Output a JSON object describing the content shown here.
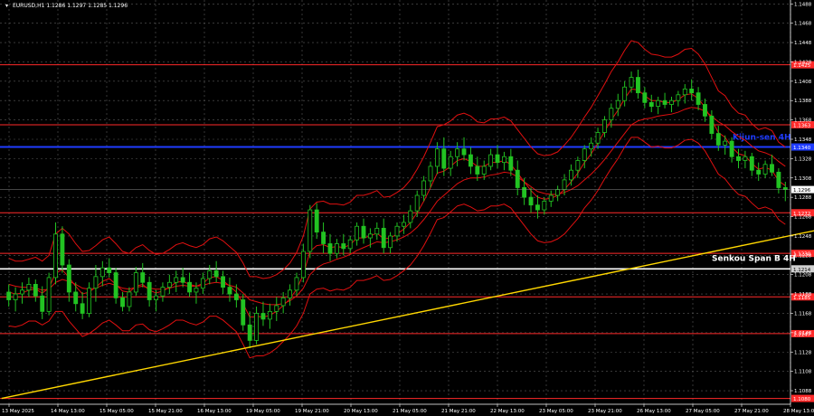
{
  "chart_data": {
    "type": "candlestick",
    "header": "EURUSD,H1  1.1286 1.1297 1.1285 1.1296",
    "ylim": [
      1.1074,
      1.1492
    ],
    "y_ticks": [
      "1.1488",
      "1.1468",
      "1.1448",
      "1.1428",
      "1.1408",
      "1.1388",
      "1.1368",
      "1.1348",
      "1.1328",
      "1.1308",
      "1.1288",
      "1.1268",
      "1.1248",
      "1.1228",
      "1.1208",
      "1.1188",
      "1.1168",
      "1.1148",
      "1.1128",
      "1.1108",
      "1.1088"
    ],
    "x_ticks": [
      "13 May 2025",
      "14 May 13:00",
      "15 May 05:00",
      "15 May 21:00",
      "16 May 13:00",
      "19 May 05:00",
      "19 May 21:00",
      "20 May 13:00",
      "21 May 05:00",
      "21 May 21:00",
      "22 May 13:00",
      "23 May 05:00",
      "23 May 21:00",
      "26 May 13:00",
      "27 May 05:00",
      "27 May 21:00",
      "28 May 13:00"
    ],
    "current_price": "1.1296",
    "levels": [
      {
        "price": 1.1425,
        "label": "1.1425",
        "color": "#ff2a2a"
      },
      {
        "price": 1.1363,
        "label": "1.1363",
        "color": "#ff2a2a"
      },
      {
        "price": 1.1272,
        "label": "1.1272",
        "color": "#ff2a2a"
      },
      {
        "price": 1.123,
        "label": "1.1230",
        "color": "#ff2a2a"
      },
      {
        "price": 1.1185,
        "label": "1.1185",
        "color": "#ff2a2a"
      },
      {
        "price": 1.1147,
        "label": "1.1147",
        "color": "#ff2a2a"
      },
      {
        "price": 1.108,
        "label": "1.1080",
        "color": "#ff2a2a"
      }
    ],
    "kijun": {
      "price": 1.134,
      "label": "Kijun-sen 4H",
      "tag": "1.1340",
      "color": "#1f3cff"
    },
    "senkou": {
      "price": 1.1214,
      "label": "Senkou Span B 4H",
      "tag": "1.1214",
      "color": "#ffffff"
    },
    "trendline": {
      "from": {
        "x": 0,
        "price": 1.108
      },
      "to": {
        "x": 155,
        "price": 1.1303
      },
      "color": "#ffd700"
    },
    "ohlc": [
      [
        1.119,
        1.1198,
        1.1175,
        1.1182
      ],
      [
        1.1182,
        1.1195,
        1.117,
        1.1188
      ],
      [
        1.1188,
        1.12,
        1.1178,
        1.1192
      ],
      [
        1.1192,
        1.1205,
        1.1185,
        1.1198
      ],
      [
        1.1198,
        1.1203,
        1.118,
        1.1186
      ],
      [
        1.1186,
        1.1196,
        1.1162,
        1.117
      ],
      [
        1.117,
        1.121,
        1.1166,
        1.1205
      ],
      [
        1.1205,
        1.1262,
        1.1198,
        1.125
      ],
      [
        1.125,
        1.1258,
        1.121,
        1.1218
      ],
      [
        1.1218,
        1.1224,
        1.118,
        1.119
      ],
      [
        1.119,
        1.12,
        1.117,
        1.1178
      ],
      [
        1.1178,
        1.119,
        1.1162,
        1.1168
      ],
      [
        1.1168,
        1.12,
        1.1164,
        1.1194
      ],
      [
        1.1194,
        1.1218,
        1.118,
        1.1206
      ],
      [
        1.1206,
        1.1222,
        1.1196,
        1.1215
      ],
      [
        1.1215,
        1.1225,
        1.1205,
        1.121
      ],
      [
        1.121,
        1.1215,
        1.1178,
        1.1184
      ],
      [
        1.1184,
        1.119,
        1.117,
        1.1175
      ],
      [
        1.1175,
        1.1195,
        1.117,
        1.119
      ],
      [
        1.119,
        1.1216,
        1.1186,
        1.121
      ],
      [
        1.121,
        1.122,
        1.1195,
        1.12
      ],
      [
        1.12,
        1.1206,
        1.1175,
        1.1182
      ],
      [
        1.1182,
        1.1192,
        1.117,
        1.1186
      ],
      [
        1.1186,
        1.12,
        1.118,
        1.1195
      ],
      [
        1.1195,
        1.1208,
        1.1188,
        1.12
      ],
      [
        1.12,
        1.1212,
        1.119,
        1.1205
      ],
      [
        1.1205,
        1.1215,
        1.1195,
        1.12
      ],
      [
        1.12,
        1.121,
        1.1185,
        1.119
      ],
      [
        1.119,
        1.12,
        1.1178,
        1.1194
      ],
      [
        1.1194,
        1.121,
        1.1188,
        1.1204
      ],
      [
        1.1204,
        1.1218,
        1.1198,
        1.1212
      ],
      [
        1.1212,
        1.1222,
        1.12,
        1.1206
      ],
      [
        1.1206,
        1.1212,
        1.1188,
        1.1195
      ],
      [
        1.1195,
        1.1205,
        1.118,
        1.1188
      ],
      [
        1.1188,
        1.1198,
        1.1174,
        1.1182
      ],
      [
        1.1182,
        1.1188,
        1.115,
        1.1156
      ],
      [
        1.1156,
        1.117,
        1.1132,
        1.114
      ],
      [
        1.114,
        1.1175,
        1.1136,
        1.1168
      ],
      [
        1.1168,
        1.118,
        1.1155,
        1.1162
      ],
      [
        1.1162,
        1.1178,
        1.1152,
        1.117
      ],
      [
        1.117,
        1.1185,
        1.116,
        1.1176
      ],
      [
        1.1176,
        1.119,
        1.1168,
        1.1184
      ],
      [
        1.1184,
        1.1198,
        1.1176,
        1.1192
      ],
      [
        1.1192,
        1.121,
        1.1186,
        1.1205
      ],
      [
        1.1205,
        1.124,
        1.12,
        1.1232
      ],
      [
        1.1232,
        1.128,
        1.1225,
        1.1275
      ],
      [
        1.1275,
        1.1282,
        1.1245,
        1.1252
      ],
      [
        1.1252,
        1.1262,
        1.123,
        1.124
      ],
      [
        1.124,
        1.125,
        1.1222,
        1.123
      ],
      [
        1.123,
        1.1245,
        1.1225,
        1.124
      ],
      [
        1.124,
        1.125,
        1.1228,
        1.1235
      ],
      [
        1.1235,
        1.1248,
        1.123,
        1.1244
      ],
      [
        1.1244,
        1.1262,
        1.1238,
        1.1258
      ],
      [
        1.1258,
        1.1266,
        1.124,
        1.1246
      ],
      [
        1.1246,
        1.1256,
        1.1236,
        1.125
      ],
      [
        1.125,
        1.1262,
        1.1244,
        1.1256
      ],
      [
        1.1256,
        1.1266,
        1.123,
        1.1236
      ],
      [
        1.1236,
        1.1252,
        1.123,
        1.1248
      ],
      [
        1.1248,
        1.1262,
        1.1242,
        1.1258
      ],
      [
        1.1258,
        1.127,
        1.125,
        1.1262
      ],
      [
        1.1262,
        1.128,
        1.1256,
        1.1274
      ],
      [
        1.1274,
        1.1295,
        1.1268,
        1.129
      ],
      [
        1.129,
        1.131,
        1.1284,
        1.1305
      ],
      [
        1.1305,
        1.1325,
        1.1298,
        1.132
      ],
      [
        1.132,
        1.1345,
        1.1312,
        1.1338
      ],
      [
        1.1338,
        1.135,
        1.131,
        1.1318
      ],
      [
        1.1318,
        1.1336,
        1.131,
        1.133
      ],
      [
        1.133,
        1.1345,
        1.132,
        1.1338
      ],
      [
        1.1338,
        1.135,
        1.1326,
        1.1332
      ],
      [
        1.1332,
        1.134,
        1.1312,
        1.132
      ],
      [
        1.132,
        1.133,
        1.1305,
        1.1312
      ],
      [
        1.1312,
        1.1326,
        1.1306,
        1.132
      ],
      [
        1.132,
        1.1338,
        1.1316,
        1.1332
      ],
      [
        1.1332,
        1.1342,
        1.1318,
        1.1324
      ],
      [
        1.1324,
        1.1335,
        1.1316,
        1.133
      ],
      [
        1.133,
        1.1338,
        1.131,
        1.1316
      ],
      [
        1.1316,
        1.1326,
        1.129,
        1.1298
      ],
      [
        1.1298,
        1.1308,
        1.128,
        1.1288
      ],
      [
        1.1288,
        1.1298,
        1.1272,
        1.128
      ],
      [
        1.128,
        1.129,
        1.1266,
        1.1275
      ],
      [
        1.1275,
        1.1288,
        1.127,
        1.1284
      ],
      [
        1.1284,
        1.1295,
        1.1278,
        1.129
      ],
      [
        1.129,
        1.13,
        1.1284,
        1.1296
      ],
      [
        1.1296,
        1.1312,
        1.129,
        1.1306
      ],
      [
        1.1306,
        1.1322,
        1.13,
        1.1316
      ],
      [
        1.1316,
        1.133,
        1.1308,
        1.1326
      ],
      [
        1.1326,
        1.1342,
        1.1318,
        1.1338
      ],
      [
        1.1338,
        1.135,
        1.133,
        1.1344
      ],
      [
        1.1344,
        1.136,
        1.1338,
        1.1355
      ],
      [
        1.1355,
        1.1372,
        1.135,
        1.1368
      ],
      [
        1.1368,
        1.1385,
        1.136,
        1.138
      ],
      [
        1.138,
        1.1395,
        1.1372,
        1.1388
      ],
      [
        1.1388,
        1.1408,
        1.1382,
        1.1402
      ],
      [
        1.1402,
        1.1418,
        1.1396,
        1.1412
      ],
      [
        1.1412,
        1.142,
        1.139,
        1.1396
      ],
      [
        1.1396,
        1.1402,
        1.138,
        1.1386
      ],
      [
        1.1386,
        1.1394,
        1.1376,
        1.1382
      ],
      [
        1.1382,
        1.1392,
        1.1374,
        1.1388
      ],
      [
        1.1388,
        1.1396,
        1.138,
        1.1384
      ],
      [
        1.1384,
        1.1392,
        1.1376,
        1.1388
      ],
      [
        1.1388,
        1.1398,
        1.1382,
        1.1394
      ],
      [
        1.1394,
        1.1405,
        1.1385,
        1.14
      ],
      [
        1.14,
        1.141,
        1.1388,
        1.1396
      ],
      [
        1.1396,
        1.1402,
        1.1378,
        1.1384
      ],
      [
        1.1384,
        1.139,
        1.1366,
        1.1372
      ],
      [
        1.1372,
        1.1378,
        1.1348,
        1.1354
      ],
      [
        1.1354,
        1.1362,
        1.1336,
        1.1342
      ],
      [
        1.1342,
        1.1352,
        1.1332,
        1.1346
      ],
      [
        1.1346,
        1.135,
        1.1324,
        1.133
      ],
      [
        1.133,
        1.1338,
        1.1318,
        1.1326
      ],
      [
        1.1326,
        1.1336,
        1.1318,
        1.133
      ],
      [
        1.133,
        1.1334,
        1.131,
        1.1316
      ],
      [
        1.1316,
        1.1324,
        1.1305,
        1.1312
      ],
      [
        1.1312,
        1.1326,
        1.1308,
        1.1322
      ],
      [
        1.1322,
        1.1332,
        1.131,
        1.1314
      ],
      [
        1.1314,
        1.1318,
        1.1292,
        1.1298
      ],
      [
        1.1298,
        1.1304,
        1.1284,
        1.1296
      ]
    ],
    "ma_fast": [
      1.119,
      1.1188,
      1.1189,
      1.1192,
      1.1193,
      1.1189,
      1.1194,
      1.121,
      1.1213,
      1.1205,
      1.1196,
      1.1188,
      1.119,
      1.1195,
      1.1201,
      1.1204,
      1.1198,
      1.1191,
      1.119,
      1.1196,
      1.1198,
      1.1192,
      1.1189,
      1.1191,
      1.1195,
      1.12,
      1.1201,
      1.1198,
      1.1196,
      1.1199,
      1.1205,
      1.1206,
      1.1202,
      1.1196,
      1.119,
      1.1178,
      1.1164,
      1.1165,
      1.1164,
      1.1166,
      1.117,
      1.1176,
      1.1183,
      1.1193,
      1.1208,
      1.1232,
      1.1238,
      1.1239,
      1.1236,
      1.1237,
      1.1236,
      1.1239,
      1.1246,
      1.1246,
      1.1248,
      1.1251,
      1.1245,
      1.1246,
      1.125,
      1.1255,
      1.1262,
      1.1272,
      1.1284,
      1.1298,
      1.1313,
      1.1315,
      1.132,
      1.1326,
      1.1328,
      1.1325,
      1.132,
      1.132,
      1.1324,
      1.1324,
      1.1326,
      1.1322,
      1.1313,
      1.1304,
      1.1295,
      1.1288,
      1.1286,
      1.1287,
      1.129,
      1.1296,
      1.1304,
      1.1313,
      1.1324,
      1.1333,
      1.1344,
      1.1356,
      1.1368,
      1.1378,
      1.139,
      1.14,
      1.1399,
      1.1393,
      1.1388,
      1.1388,
      1.1386,
      1.1386,
      1.1389,
      1.1394,
      1.1395,
      1.139,
      1.1381,
      1.1368,
      1.1355,
      1.135,
      1.134,
      1.1333,
      1.1331,
      1.1323,
      1.1317,
      1.1319,
      1.1316,
      1.1305,
      1.13
    ],
    "ma_slow": [
      1.1198,
      1.1196,
      1.1195,
      1.1195,
      1.1194,
      1.1192,
      1.1193,
      1.12,
      1.1203,
      1.1201,
      1.1198,
      1.1194,
      1.1193,
      1.1194,
      1.1197,
      1.1199,
      1.1197,
      1.1194,
      1.1193,
      1.1195,
      1.1196,
      1.1194,
      1.1193,
      1.1193,
      1.1194,
      1.1196,
      1.1197,
      1.1196,
      1.1196,
      1.1197,
      1.1199,
      1.12,
      1.1199,
      1.1197,
      1.1195,
      1.1189,
      1.1182,
      1.118,
      1.1178,
      1.1177,
      1.1177,
      1.1178,
      1.1181,
      1.1186,
      1.1194,
      1.1208,
      1.1215,
      1.1219,
      1.1221,
      1.1224,
      1.1226,
      1.1229,
      1.1233,
      1.1236,
      1.1239,
      1.1242,
      1.1241,
      1.1242,
      1.1244,
      1.1247,
      1.1251,
      1.1257,
      1.1265,
      1.1274,
      1.1284,
      1.129,
      1.1296,
      1.1302,
      1.1306,
      1.1308,
      1.1308,
      1.1309,
      1.1311,
      1.1312,
      1.1314,
      1.1313,
      1.1309,
      1.1304,
      1.1299,
      1.1294,
      1.1292,
      1.1291,
      1.1291,
      1.1293,
      1.1296,
      1.13,
      1.1306,
      1.1312,
      1.1319,
      1.1327,
      1.1336,
      1.1345,
      1.1354,
      1.1363,
      1.1367,
      1.1369,
      1.137,
      1.1372,
      1.1373,
      1.1374,
      1.1376,
      1.1379,
      1.1381,
      1.138,
      1.1377,
      1.1372,
      1.1366,
      1.1362,
      1.1356,
      1.1351,
      1.1347,
      1.1341,
      1.1336,
      1.1334,
      1.1331,
      1.1325,
      1.132
    ],
    "band_upper": [
      1.1225,
      1.1222,
      1.1222,
      1.1224,
      1.1226,
      1.1222,
      1.1228,
      1.125,
      1.1256,
      1.125,
      1.124,
      1.1232,
      1.1233,
      1.1238,
      1.1244,
      1.1247,
      1.124,
      1.1232,
      1.123,
      1.1236,
      1.1239,
      1.1233,
      1.1229,
      1.123,
      1.1234,
      1.1239,
      1.1241,
      1.1238,
      1.1236,
      1.1239,
      1.1245,
      1.1247,
      1.1243,
      1.1237,
      1.1231,
      1.122,
      1.1206,
      1.1206,
      1.1204,
      1.1205,
      1.1208,
      1.1213,
      1.122,
      1.1231,
      1.1248,
      1.1276,
      1.1283,
      1.1284,
      1.1281,
      1.1281,
      1.128,
      1.1283,
      1.129,
      1.129,
      1.1292,
      1.1295,
      1.1288,
      1.1289,
      1.1293,
      1.1298,
      1.1306,
      1.1317,
      1.133,
      1.1345,
      1.1361,
      1.1363,
      1.1367,
      1.1373,
      1.1375,
      1.1372,
      1.1366,
      1.1365,
      1.1369,
      1.1369,
      1.1371,
      1.1367,
      1.1358,
      1.1349,
      1.134,
      1.1333,
      1.1331,
      1.1332,
      1.1335,
      1.1342,
      1.135,
      1.136,
      1.1371,
      1.1381,
      1.1393,
      1.1405,
      1.1418,
      1.1428,
      1.144,
      1.145,
      1.1448,
      1.1441,
      1.1436,
      1.1435,
      1.1433,
      1.1433,
      1.1436,
      1.1441,
      1.1442,
      1.1436,
      1.1426,
      1.1412,
      1.1398,
      1.1393,
      1.1382,
      1.1375,
      1.1373,
      1.1364,
      1.1358,
      1.136,
      1.1357,
      1.1345,
      1.134
    ],
    "band_lower": [
      1.1155,
      1.1154,
      1.1156,
      1.116,
      1.116,
      1.1156,
      1.116,
      1.117,
      1.117,
      1.116,
      1.1152,
      1.1144,
      1.1147,
      1.1152,
      1.1158,
      1.1161,
      1.1156,
      1.115,
      1.115,
      1.1156,
      1.1157,
      1.1151,
      1.1149,
      1.1152,
      1.1156,
      1.1161,
      1.1161,
      1.1158,
      1.1156,
      1.1159,
      1.1165,
      1.1165,
      1.1161,
      1.1155,
      1.1149,
      1.1136,
      1.1122,
      1.1124,
      1.1124,
      1.1127,
      1.1132,
      1.1139,
      1.1146,
      1.1155,
      1.1168,
      1.1188,
      1.1193,
      1.1194,
      1.1191,
      1.1193,
      1.1192,
      1.1195,
      1.1202,
      1.1202,
      1.1204,
      1.1207,
      1.1202,
      1.1203,
      1.1207,
      1.1212,
      1.1218,
      1.1227,
      1.1238,
      1.1251,
      1.1265,
      1.1267,
      1.1273,
      1.1279,
      1.1281,
      1.1278,
      1.1274,
      1.1275,
      1.1279,
      1.1279,
      1.1281,
      1.1277,
      1.1268,
      1.1259,
      1.125,
      1.1243,
      1.1241,
      1.1242,
      1.1245,
      1.125,
      1.1258,
      1.1266,
      1.1277,
      1.1285,
      1.1295,
      1.1307,
      1.1318,
      1.1328,
      1.134,
      1.135,
      1.135,
      1.1345,
      1.134,
      1.1341,
      1.1339,
      1.1339,
      1.1342,
      1.1347,
      1.1348,
      1.1344,
      1.1336,
      1.1324,
      1.1312,
      1.1307,
      1.1298,
      1.1291,
      1.1289,
      1.1282,
      1.1276,
      1.1278,
      1.1275,
      1.1265,
      1.126
    ]
  }
}
